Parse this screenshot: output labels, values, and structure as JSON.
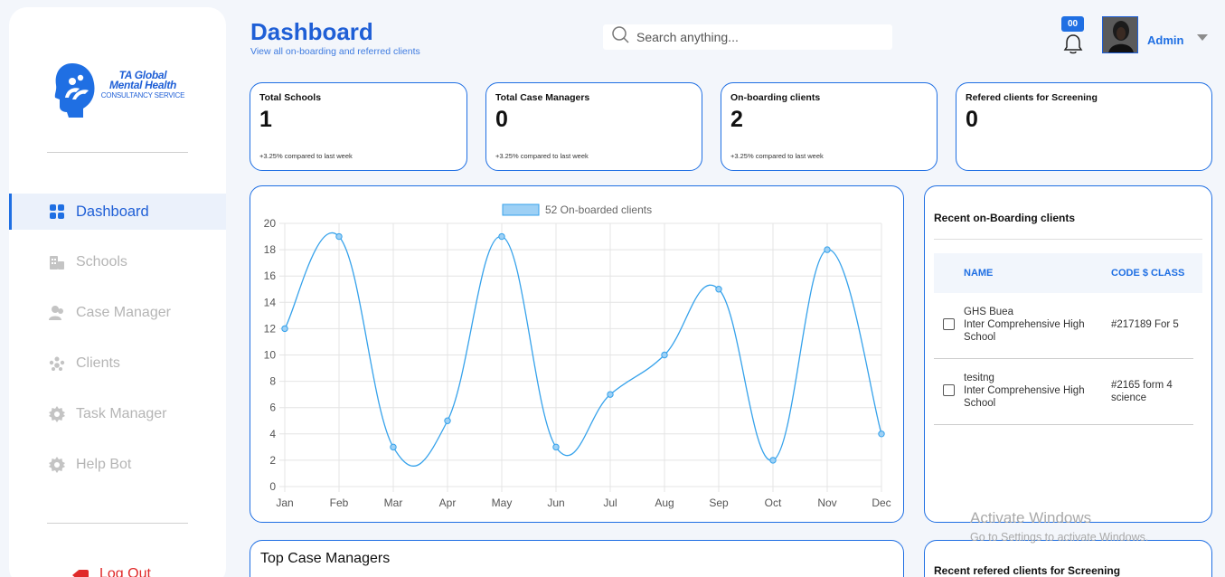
{
  "brand": {
    "line1": "TA Global",
    "line2": "Mental Health",
    "line3": "CONSULTANCY SERVICE"
  },
  "sidebar": {
    "items": [
      {
        "label": "Dashboard",
        "icon": "grid-icon",
        "active": true
      },
      {
        "label": "Schools",
        "icon": "school-icon",
        "active": false
      },
      {
        "label": "Case Manager",
        "icon": "users-icon",
        "active": false
      },
      {
        "label": "Clients",
        "icon": "group-icon",
        "active": false
      },
      {
        "label": "Task Manager",
        "icon": "gear-icon",
        "active": false
      },
      {
        "label": "Help Bot",
        "icon": "gear-icon",
        "active": false
      }
    ],
    "logout": "Log Out"
  },
  "header": {
    "title": "Dashboard",
    "subtitle": "View all on-boarding and referred clients",
    "search_placeholder": "Search anything...",
    "notification_count": "00",
    "user_name": "Admin"
  },
  "stats": [
    {
      "title": "Total Schools",
      "value": "1",
      "foot": "+3.25% compared to last week"
    },
    {
      "title": "Total Case Managers",
      "value": "0",
      "foot": "+3.25% compared to last week"
    },
    {
      "title": "On-boarding clients",
      "value": "2",
      "foot": "+3.25% compared to last week"
    },
    {
      "title": "Refered clients for Screening",
      "value": "0",
      "foot": ""
    }
  ],
  "chart_data": {
    "type": "line",
    "categories": [
      "Jan",
      "Feb",
      "Mar",
      "Apr",
      "May",
      "Jun",
      "Jul",
      "Aug",
      "Sep",
      "Oct",
      "Nov",
      "Dec"
    ],
    "series": [
      {
        "name": "52 On-boarded clients",
        "values": [
          12,
          19,
          3,
          5,
          19,
          3,
          7,
          10,
          15,
          2,
          18,
          4
        ],
        "color": "#36a2eb"
      }
    ],
    "ylim": [
      0,
      20
    ],
    "yticks": [
      0,
      2,
      4,
      6,
      8,
      10,
      12,
      14,
      16,
      18,
      20
    ],
    "grid": true,
    "legend": "top"
  },
  "recent": {
    "title": "Recent on-Boarding clients",
    "columns": [
      "NAME",
      "CODE $ CLASS"
    ],
    "rows": [
      {
        "name_line1": "GHS Buea",
        "name_line2": "Inter Comprehensive High School",
        "code": "#217189 For 5"
      },
      {
        "name_line1": "tesitng",
        "name_line2": "Inter Comprehensive High School",
        "code": "#2165 form 4 science"
      }
    ]
  },
  "bottom": {
    "top_case_managers": "Top Case Managers",
    "recent_referred": "Recent refered clients for Screening"
  },
  "watermark": {
    "line1": "Activate Windows",
    "line2": "Go to Settings to activate Windows."
  }
}
